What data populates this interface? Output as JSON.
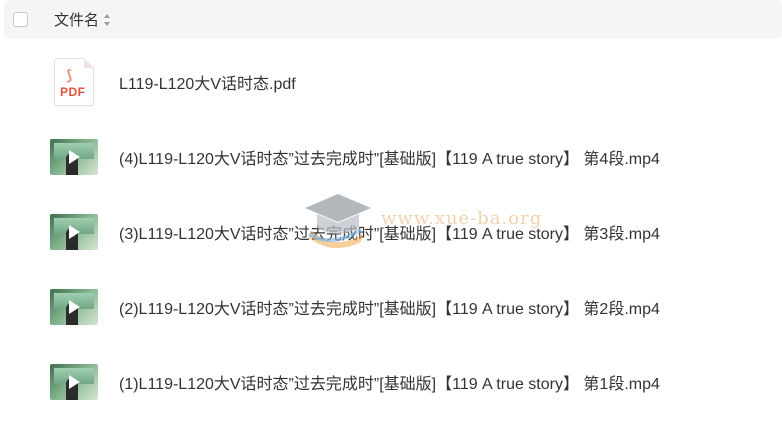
{
  "header": {
    "column_label": "文件名"
  },
  "files": [
    {
      "name": "L119-L120大V话时态.pdf",
      "type": "pdf",
      "icon_text": "PDF"
    },
    {
      "name": "(4)L119-L120大V话时态”过去完成时”[基础版]【119 A true story】 第4段.mp4",
      "type": "video"
    },
    {
      "name": "(3)L119-L120大V话时态”过去完成时”[基础版]【119 A true story】 第3段.mp4",
      "type": "video"
    },
    {
      "name": "(2)L119-L120大V话时态”过去完成时”[基础版]【119 A true story】 第2段.mp4",
      "type": "video"
    },
    {
      "name": "(1)L119-L120大V话时态”过去完成时”[基础版]【119 A true story】 第1段.mp4",
      "type": "video"
    }
  ],
  "watermark": {
    "text": "www.xue-ba.org"
  },
  "colors": {
    "header_bg": "#f5f5f6",
    "text": "#333333",
    "pdf_red": "#e0533e"
  }
}
